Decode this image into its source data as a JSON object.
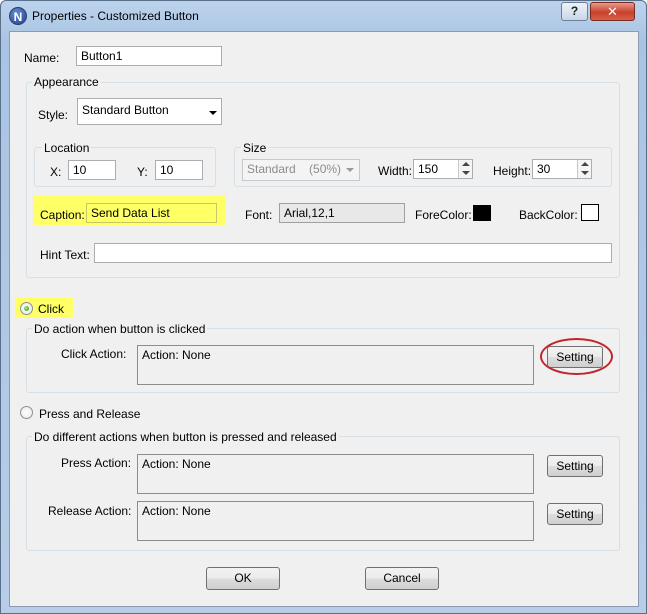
{
  "window": {
    "title": "Properties - Customized Button",
    "app_icon_letter": "N",
    "help_glyph": "?",
    "close_glyph": "✕"
  },
  "name": {
    "label": "Name:",
    "value": "Button1"
  },
  "appearance": {
    "group_label": "Appearance",
    "style": {
      "label": "Style:",
      "value": "Standard Button"
    },
    "location": {
      "group_label": "Location",
      "x_label": "X:",
      "x_value": "10",
      "y_label": "Y:",
      "y_value": "10"
    },
    "size": {
      "group_label": "Size",
      "preset_value": "Standard    (50%)",
      "width_label": "Width:",
      "width_value": "150",
      "height_label": "Height:",
      "height_value": "30"
    },
    "caption": {
      "label": "Caption:",
      "value": "Send Data List"
    },
    "font": {
      "label": "Font:",
      "value": "Arial,12,1"
    },
    "forecolor": {
      "label": "ForeColor:",
      "color": "#000000"
    },
    "backcolor": {
      "label": "BackColor:",
      "color": "#ffffff"
    },
    "hint": {
      "label": "Hint Text:",
      "value": ""
    }
  },
  "click_mode": {
    "label": "Click",
    "selected": true,
    "group_label": "Do action when button is clicked",
    "action_label": "Click Action:",
    "action_value": "Action: None",
    "setting_label": "Setting"
  },
  "press_release_mode": {
    "label": "Press and Release",
    "selected": false,
    "group_label": "Do different actions when button is pressed and released",
    "press_label": "Press Action:",
    "press_value": "Action: None",
    "press_setting_label": "Setting",
    "release_label": "Release Action:",
    "release_value": "Action: None",
    "release_setting_label": "Setting"
  },
  "footer": {
    "ok_label": "OK",
    "cancel_label": "Cancel"
  },
  "colors": {
    "highlight": "#ffff66",
    "annotation_ring": "#c0262c",
    "title_gradient": "#bcd3ec"
  }
}
